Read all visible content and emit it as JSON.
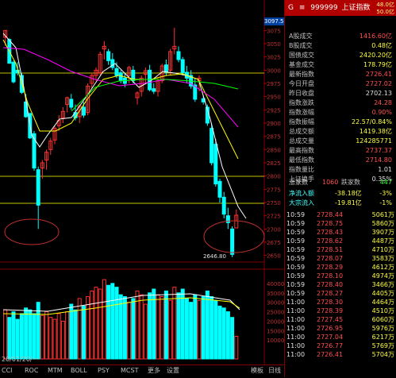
{
  "header": {
    "code_prefix": "G",
    "menu_icon_char": "≡",
    "code": "999999",
    "name": "上证指数",
    "top_right_1": "48.0亿",
    "top_right_2": "50.0亿",
    "top_left_hint": "3097.5"
  },
  "quote_rows": [
    {
      "label": "A股成交",
      "value": "1416.60亿",
      "color": "red"
    },
    {
      "label": "B股成交",
      "value": "0.48亿",
      "color": "yel"
    },
    {
      "label": "国债成交",
      "value": "2420.20亿",
      "color": "yel"
    },
    {
      "label": "基金成交",
      "value": "178.79亿",
      "color": "yel"
    },
    {
      "label": "最新指数",
      "value": "2726.41",
      "color": "red"
    },
    {
      "label": "今日开盘",
      "value": "2727.02",
      "color": "red"
    },
    {
      "label": "昨日收盘",
      "value": "2702.13",
      "color": "wht"
    },
    {
      "label": "指数涨跌",
      "value": "24.28",
      "color": "red"
    },
    {
      "label": "指数涨幅",
      "value": "0.90%",
      "color": "red"
    },
    {
      "label": "指数振幅",
      "value": "22.57/0.84%",
      "color": "yel"
    },
    {
      "label": "总成交额",
      "value": "1419.38亿",
      "color": "yel"
    },
    {
      "label": "总成交量",
      "value": "124285771",
      "color": "yel"
    },
    {
      "label": "最高指数",
      "value": "2737.37",
      "color": "red"
    },
    {
      "label": "最低指数",
      "value": "2714.80",
      "color": "red"
    },
    {
      "label": "指数量比",
      "value": "1.01",
      "color": "wht"
    },
    {
      "label": "上证换手",
      "value": "0.35%",
      "color": "wht"
    }
  ],
  "advance_decline": {
    "up_label": "涨家数",
    "up_value": "1060",
    "down_label": "跌家数",
    "down_value": "447"
  },
  "flows": [
    {
      "label": "净流入额",
      "value": "-38.18亿",
      "pct": "-3%"
    },
    {
      "label": "大宗流入",
      "value": "-19.81亿",
      "pct": "-1%"
    }
  ],
  "ticks": [
    {
      "time": "10:59",
      "price": "2728.44",
      "vol": "5061万"
    },
    {
      "time": "10:59",
      "price": "2728.75",
      "vol": "5860万"
    },
    {
      "time": "10:59",
      "price": "2728.43",
      "vol": "3907万"
    },
    {
      "time": "10:59",
      "price": "2728.62",
      "vol": "4487万"
    },
    {
      "time": "10:59",
      "price": "2728.51",
      "vol": "4710万"
    },
    {
      "time": "10:59",
      "price": "2728.07",
      "vol": "3583万"
    },
    {
      "time": "10:59",
      "price": "2728.29",
      "vol": "4612万"
    },
    {
      "time": "10:59",
      "price": "2728.10",
      "vol": "4974万"
    },
    {
      "time": "10:59",
      "price": "2728.40",
      "vol": "3466万"
    },
    {
      "time": "10:59",
      "price": "2728.27",
      "vol": "4405万"
    },
    {
      "time": "11:00",
      "price": "2728.30",
      "vol": "4464万"
    },
    {
      "time": "11:00",
      "price": "2728.39",
      "vol": "4510万"
    },
    {
      "time": "11:00",
      "price": "2727.45",
      "vol": "6060万"
    },
    {
      "time": "11:00",
      "price": "2726.95",
      "vol": "5976万"
    },
    {
      "time": "11:00",
      "price": "2727.04",
      "vol": "6217万"
    },
    {
      "time": "11:00",
      "price": "2726.77",
      "vol": "5769万"
    },
    {
      "time": "11:00",
      "price": "2726.41",
      "vol": "5704万"
    }
  ],
  "price_axis_labels": [
    "3075",
    "3050",
    "3025",
    "3000",
    "2975",
    "2950",
    "2925",
    "2900",
    "2875",
    "2850",
    "2825",
    "2800",
    "2775",
    "2750",
    "2725",
    "2700",
    "2675",
    "2650"
  ],
  "volume_axis_labels": [
    "40000",
    "35000",
    "30000",
    "25000",
    "20000",
    "15000",
    "10000"
  ],
  "low_marker": "2646.80",
  "bottom_tabs": [
    "CCI",
    "ROC",
    "MTM",
    "BOLL",
    "PSY",
    "MCST",
    "更多",
    "设置"
  ],
  "date_label": "20/01/20/一",
  "bottom_right_tabs": [
    "模板",
    "日线"
  ],
  "colors": {
    "up": "#ff3030",
    "down": "#00ffff",
    "ma5": "#ffffff",
    "ma10": "#ffff00",
    "ma20": "#ff00ff",
    "ma60": "#00ff00",
    "grid": "#800000"
  }
}
